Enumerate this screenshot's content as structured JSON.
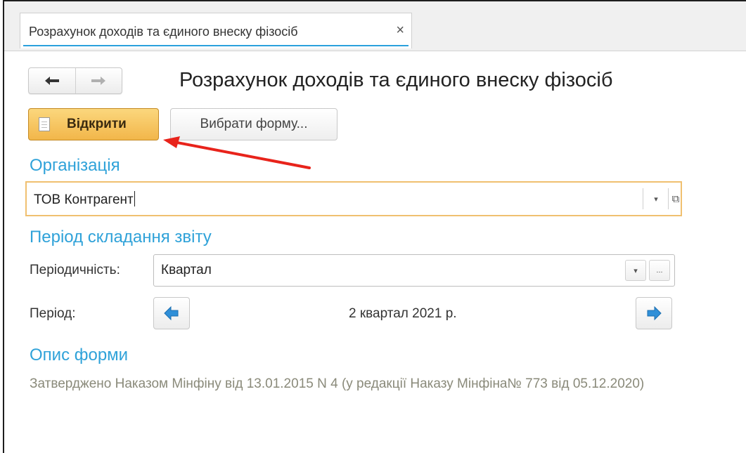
{
  "tab": {
    "title": "Розрахунок доходів та єдиного внеску фізосіб",
    "close_glyph": "×"
  },
  "nav": {
    "back_icon": "arrow-left-icon",
    "forward_icon": "arrow-right-icon"
  },
  "page": {
    "title": "Розрахунок доходів та єдиного внеску фізосіб"
  },
  "toolbar": {
    "open_label": "Відкрити",
    "choose_form_label": "Вибрати форму..."
  },
  "organization": {
    "section_title": "Організація",
    "value": "ТОВ Контрагент",
    "dropdown_glyph": "▾",
    "open_glyph": "⧉"
  },
  "period_section": {
    "title": "Період складання звіту",
    "periodicity_label": "Періодичність:",
    "periodicity_value": "Квартал",
    "dropdown_glyph": "▾",
    "ellipsis_glyph": "...",
    "period_label": "Період:",
    "period_value": "2 квартал 2021 р."
  },
  "form_description": {
    "title": "Опис форми",
    "text": "Затверджено Наказом Мінфіну від 13.01.2015 N 4 (у редакції Наказу Мінфіна№ 773 від 05.12.2020)"
  },
  "colors": {
    "accent": "#2fa2d9",
    "primary_button": "#f2b64a",
    "annotation_arrow": "#e8231b"
  }
}
